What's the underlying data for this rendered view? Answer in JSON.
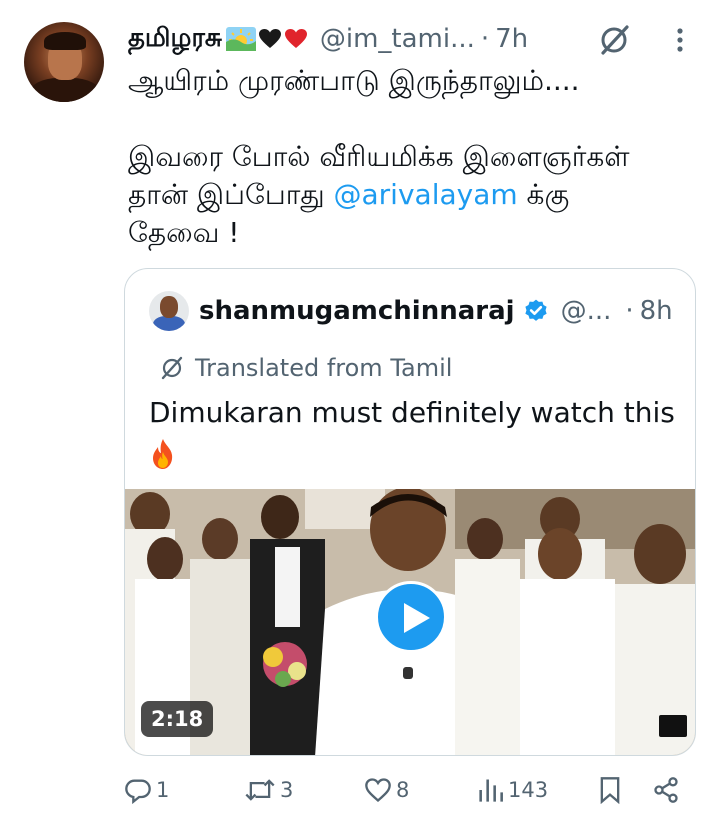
{
  "tweet": {
    "author": {
      "display_name": "தமிழரசு",
      "handle": "@im_tami...",
      "time": "7h"
    },
    "separator": "·",
    "body": {
      "line1": "ஆயிரம் முரண்பாடு இருந்தாலும்....",
      "line2": "இவரை போல் வீரியமிக்க இளைஞர்கள்",
      "line3_prefix": "தான் இப்போது ",
      "mention": "@arivalayam",
      "line3_suffix": " க்கு",
      "line4": "தேவை !"
    },
    "quote": {
      "display_name": "shanmugamchinnaraj",
      "handle": "@...",
      "time": "8h",
      "translated_label": "Translated from Tamil",
      "text": "Dimukaran must definitely watch this",
      "video_duration": "2:18"
    },
    "actions": {
      "replies": "1",
      "reposts": "3",
      "likes": "8",
      "views": "143"
    }
  },
  "icons": {
    "grok": "grok-icon",
    "more": "more-icon",
    "verified": "verified-badge-icon",
    "translate": "translate-icon",
    "play": "play-icon",
    "reply": "reply-icon",
    "repost": "repost-icon",
    "like": "heart-icon",
    "views": "views-icon",
    "bookmark": "bookmark-icon",
    "share": "share-icon"
  },
  "colors": {
    "accent": "#1d9bf0",
    "text": "#0f1419",
    "muted": "#536471",
    "border": "#cfd9de"
  }
}
